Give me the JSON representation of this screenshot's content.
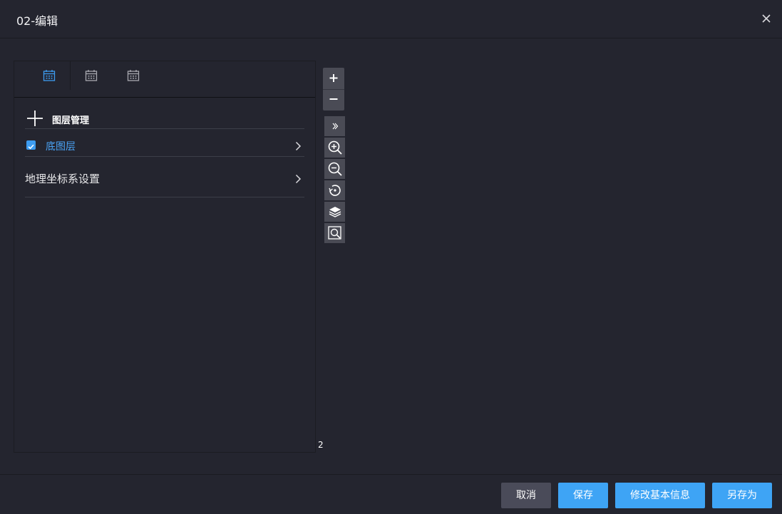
{
  "dialog": {
    "title": "02-编辑"
  },
  "tabs": [
    {
      "icon": "calendar-icon",
      "active": true
    },
    {
      "icon": "calendar-icon",
      "active": false
    },
    {
      "icon": "calendar-icon",
      "active": false
    }
  ],
  "layer_panel": {
    "title": "图层管理",
    "layers": [
      {
        "name": "底图层",
        "checked": true
      }
    ],
    "geo_settings_label": "地理坐标系设置"
  },
  "map_tools": {
    "zoom_in": "+",
    "zoom_out": "−",
    "scale_label": "2",
    "tools": [
      "expand-icon",
      "zoom-in-icon",
      "zoom-out-icon",
      "reset-icon",
      "layers-icon",
      "search-area-icon"
    ]
  },
  "footer": {
    "cancel": "取消",
    "save": "保存",
    "edit_info": "修改基本信息",
    "save_as": "另存为"
  },
  "colors": {
    "accent": "#3ea4f5",
    "background": "#24252f",
    "tool_bg": "#4a4b55"
  }
}
